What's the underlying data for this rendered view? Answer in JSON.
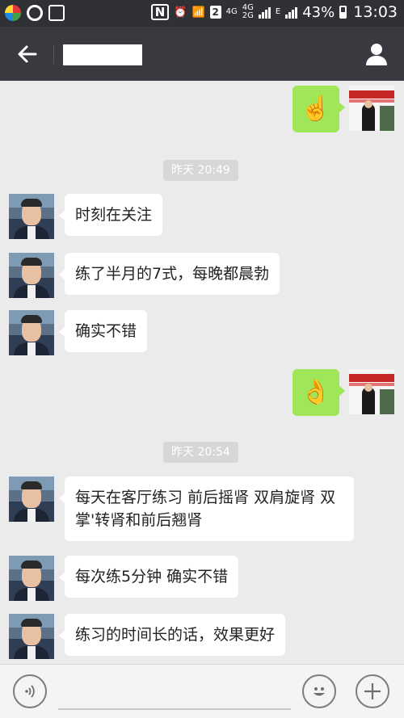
{
  "status_bar": {
    "network_small": "4G",
    "network_stack": "4G",
    "network_stack2": "2G",
    "network_type": "E",
    "sim_badge": "2",
    "battery_percent": "43%",
    "time": "13:03"
  },
  "header": {
    "back_icon": "back-arrow-icon",
    "contact_name": "",
    "profile_icon": "user-icon"
  },
  "messages": [
    {
      "type": "self_emoji",
      "emoji": "☝️"
    },
    {
      "type": "timestamp",
      "text": "昨天 20:49"
    },
    {
      "type": "incoming",
      "text": "时刻在关注"
    },
    {
      "type": "incoming",
      "text": "练了半月的7式，每晚都晨勃"
    },
    {
      "type": "incoming",
      "text": "确实不错"
    },
    {
      "type": "self_emoji",
      "emoji": "👌"
    },
    {
      "type": "timestamp",
      "text": "昨天 20:54"
    },
    {
      "type": "incoming",
      "text": "每天在客厅练习 前后摇肾 双肩旋肾 双掌'转肾和前后翘肾"
    },
    {
      "type": "incoming",
      "text": "每次练5分钟 确实不错"
    },
    {
      "type": "incoming",
      "text": "练习的时间长的话，效果更好"
    }
  ],
  "input_bar": {
    "voice_icon": "voice-icon",
    "emoji_icon": "emoji-icon",
    "plus_icon": "plus-icon"
  }
}
